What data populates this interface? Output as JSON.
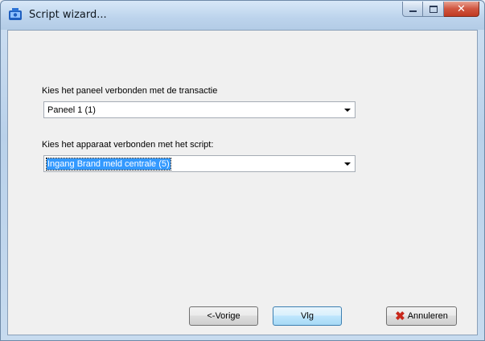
{
  "window": {
    "title": "Script wizard...",
    "icon": "script-wizard-app-icon"
  },
  "caption_buttons": {
    "minimize_icon": "minimize-icon",
    "maximize_icon": "maximize-icon",
    "close_icon": "close-icon"
  },
  "panel_select": {
    "label": "Kies het paneel verbonden met de transactie",
    "value": "Paneel 1  (1)"
  },
  "device_select": {
    "label": "Kies het apparaat verbonden met het script:",
    "value": "Ingang Brand meld centrale  (5)"
  },
  "buttons": {
    "previous": "<-Vorige",
    "next": "Vlg",
    "cancel": "Annuleren"
  },
  "colors": {
    "selection": "#3399ff",
    "cancel_icon": "#c8281c"
  }
}
